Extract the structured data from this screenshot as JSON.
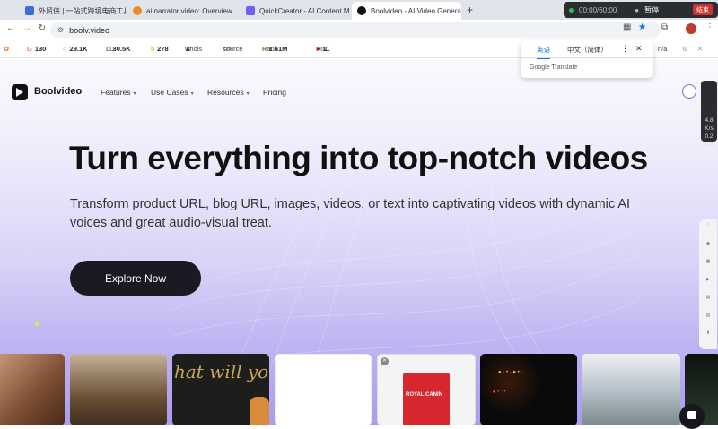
{
  "tabs": [
    {
      "title": "外贸侠 | 一站式跨境电商工具站",
      "color": "#3b6fd8"
    },
    {
      "title": "ai narrator video: Overview",
      "color": "#f08a24"
    },
    {
      "title": "QuickCreator - AI Content M",
      "color": "#7a5af5"
    },
    {
      "title": "Boolvideo - AI Video Genera",
      "color": "#111111"
    }
  ],
  "new_tab_icon": "+",
  "recorder": {
    "time": "00:00/60:00",
    "pause": "暂停",
    "stop": "结束"
  },
  "address": {
    "url": "boolv.video"
  },
  "bookmarks": [
    {
      "label": "",
      "value": "130"
    },
    {
      "label": "",
      "value": "29.1K"
    },
    {
      "label": "LD",
      "value": "30.5K"
    },
    {
      "label": "",
      "value": "278"
    },
    {
      "label": "whois",
      "value": ""
    },
    {
      "label": "source",
      "value": ""
    },
    {
      "label": "Rank",
      "value": "1.61M"
    },
    {
      "label": "PIN",
      "value": "11"
    }
  ],
  "bookmarks_tail": "n/a",
  "translate_popup": {
    "tab_en": "英语",
    "tab_zh": "中文（简体）",
    "footer": "Google Translate"
  },
  "site": {
    "brand": "Boolvideo",
    "menu": [
      "Features",
      "Use Cases",
      "Resources",
      "Pricing"
    ],
    "menu_has_chevron": [
      true,
      true,
      true,
      false
    ],
    "headline": "Turn everything into top-notch videos",
    "subheadline": "Transform product URL, blog URL, images, videos, or text into captivating videos with dynamic AI voices and great audio-visual treat.",
    "cta": "Explore Now"
  },
  "side_panel": {
    "v1": "4.8",
    "u1": "K/s",
    "v2": "0.2",
    "u2": "K/s"
  },
  "thumbnails": [
    {
      "kind": "portrait-hair",
      "color": "#8a5a3c"
    },
    {
      "kind": "interior",
      "color": "#5e4a34"
    },
    {
      "kind": "script-text",
      "color": "#1d1d1b",
      "text": "hat will you"
    },
    {
      "kind": "blank",
      "color": "#ffffff"
    },
    {
      "kind": "product-bag",
      "color": "#f2f2f2",
      "text": "ROYAL CANIN"
    },
    {
      "kind": "sparkles",
      "color": "#0a0a0a"
    },
    {
      "kind": "street",
      "color": "#a7b4bf"
    },
    {
      "kind": "dark-green",
      "color": "#1e2a22"
    }
  ],
  "colors": {
    "accent": "#7b6ad9",
    "cta_bg": "#1b1a22"
  }
}
